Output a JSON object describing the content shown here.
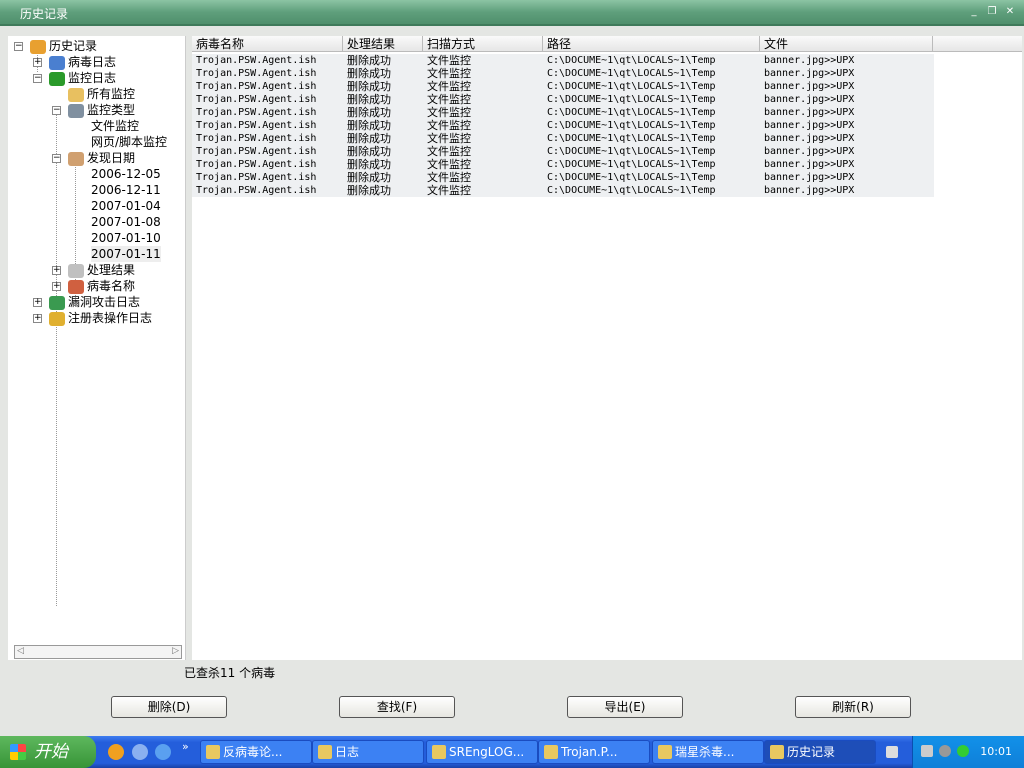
{
  "window": {
    "title": "历史记录"
  },
  "tree": [
    {
      "label": "历史记录",
      "exp": "−"
    },
    {
      "label": "病毒日志",
      "exp": "+"
    },
    {
      "label": "监控日志",
      "exp": "−"
    },
    {
      "label": "所有监控"
    },
    {
      "label": "监控类型",
      "exp": "−"
    },
    {
      "label": "文件监控"
    },
    {
      "label": "网页/脚本监控"
    },
    {
      "label": "发现日期",
      "exp": "−"
    },
    {
      "label": "2006-12-05"
    },
    {
      "label": "2006-12-11"
    },
    {
      "label": "2007-01-04"
    },
    {
      "label": "2007-01-08"
    },
    {
      "label": "2007-01-10"
    },
    {
      "label": "2007-01-11"
    },
    {
      "label": "处理结果",
      "exp": "+"
    },
    {
      "label": "病毒名称",
      "exp": "+"
    },
    {
      "label": "漏洞攻击日志",
      "exp": "+"
    },
    {
      "label": "注册表操作日志",
      "exp": "+"
    }
  ],
  "columns": [
    "病毒名称",
    "处理结果",
    "扫描方式",
    "路径",
    "文件"
  ],
  "rows": [
    [
      "Trojan.PSW.Agent.ish",
      "删除成功",
      "文件监控",
      "C:\\DOCUME~1\\qt\\LOCALS~1\\Temp",
      "banner.jpg>>UPX"
    ],
    [
      "Trojan.PSW.Agent.ish",
      "删除成功",
      "文件监控",
      "C:\\DOCUME~1\\qt\\LOCALS~1\\Temp",
      "banner.jpg>>UPX"
    ],
    [
      "Trojan.PSW.Agent.ish",
      "删除成功",
      "文件监控",
      "C:\\DOCUME~1\\qt\\LOCALS~1\\Temp",
      "banner.jpg>>UPX"
    ],
    [
      "Trojan.PSW.Agent.ish",
      "删除成功",
      "文件监控",
      "C:\\DOCUME~1\\qt\\LOCALS~1\\Temp",
      "banner.jpg>>UPX"
    ],
    [
      "Trojan.PSW.Agent.ish",
      "删除成功",
      "文件监控",
      "C:\\DOCUME~1\\qt\\LOCALS~1\\Temp",
      "banner.jpg>>UPX"
    ],
    [
      "Trojan.PSW.Agent.ish",
      "删除成功",
      "文件监控",
      "C:\\DOCUME~1\\qt\\LOCALS~1\\Temp",
      "banner.jpg>>UPX"
    ],
    [
      "Trojan.PSW.Agent.ish",
      "删除成功",
      "文件监控",
      "C:\\DOCUME~1\\qt\\LOCALS~1\\Temp",
      "banner.jpg>>UPX"
    ],
    [
      "Trojan.PSW.Agent.ish",
      "删除成功",
      "文件监控",
      "C:\\DOCUME~1\\qt\\LOCALS~1\\Temp",
      "banner.jpg>>UPX"
    ],
    [
      "Trojan.PSW.Agent.ish",
      "删除成功",
      "文件监控",
      "C:\\DOCUME~1\\qt\\LOCALS~1\\Temp",
      "banner.jpg>>UPX"
    ],
    [
      "Trojan.PSW.Agent.ish",
      "删除成功",
      "文件监控",
      "C:\\DOCUME~1\\qt\\LOCALS~1\\Temp",
      "banner.jpg>>UPX"
    ],
    [
      "Trojan.PSW.Agent.ish",
      "删除成功",
      "文件监控",
      "C:\\DOCUME~1\\qt\\LOCALS~1\\Temp",
      "banner.jpg>>UPX"
    ]
  ],
  "status": "已查杀11 个病毒",
  "buttons": {
    "delete": "删除(D)",
    "find": "查找(F)",
    "export": "导出(E)",
    "refresh": "刷新(R)"
  },
  "taskbar": {
    "start": "开始",
    "more": "»",
    "items": [
      "反病毒论...",
      "日志",
      "SREngLOG...",
      "Trojan.P...",
      "瑞星杀毒...",
      "历史记录"
    ],
    "clock": "10:01"
  }
}
